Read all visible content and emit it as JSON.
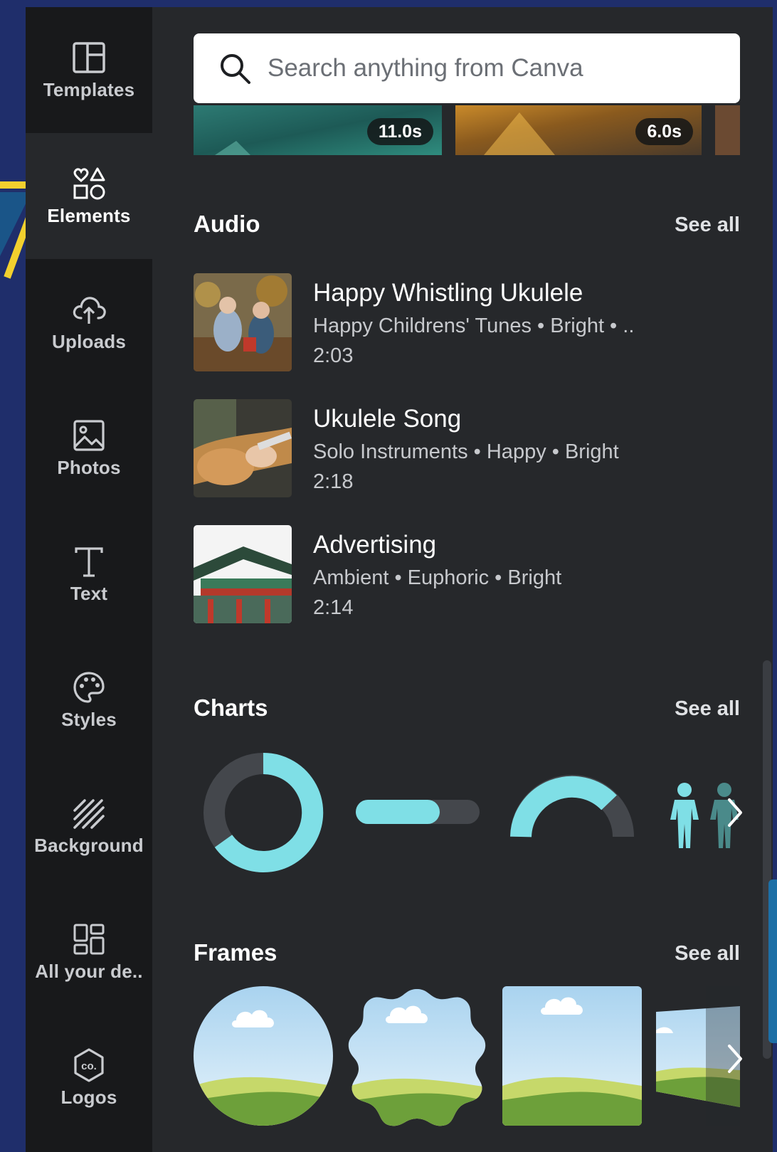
{
  "sidebar": {
    "items": [
      {
        "label": "Templates",
        "icon": "templates-icon"
      },
      {
        "label": "Elements",
        "icon": "elements-icon"
      },
      {
        "label": "Uploads",
        "icon": "upload-cloud-icon"
      },
      {
        "label": "Photos",
        "icon": "photo-icon"
      },
      {
        "label": "Text",
        "icon": "text-icon"
      },
      {
        "label": "Styles",
        "icon": "palette-icon"
      },
      {
        "label": "Background",
        "icon": "background-hatch-icon"
      },
      {
        "label": "All your de..",
        "icon": "all-designs-icon"
      },
      {
        "label": "Logos",
        "icon": "logo-icon"
      }
    ],
    "active": "Elements"
  },
  "search": {
    "placeholder": "Search anything from Canva"
  },
  "videos": [
    {
      "duration": "11.0s"
    },
    {
      "duration": "6.0s"
    }
  ],
  "audio": {
    "title": "Audio",
    "see_all": "See all",
    "tracks": [
      {
        "title": "Happy Whistling Ukulele",
        "subtitle": "Happy Childrens' Tunes • Bright • ..",
        "duration": "2:03"
      },
      {
        "title": "Ukulele Song",
        "subtitle": "Solo Instruments • Happy • Bright",
        "duration": "2:18"
      },
      {
        "title": "Advertising",
        "subtitle": "Ambient • Euphoric • Bright",
        "duration": "2:14"
      }
    ]
  },
  "charts": {
    "title": "Charts",
    "see_all": "See all",
    "items": [
      "donut-chart",
      "progress-bar",
      "half-gauge",
      "pictogram"
    ]
  },
  "frames": {
    "title": "Frames",
    "see_all": "See all",
    "items": [
      "circle-frame",
      "scalloped-frame",
      "square-frame",
      "skewed-frame"
    ]
  },
  "colors": {
    "accent": "#7fdfe6",
    "sidebar_bg": "#18191b",
    "panel_bg": "#26282b",
    "page_bg": "#1f2e6b",
    "highlight_arrow": "#f2d02e"
  }
}
